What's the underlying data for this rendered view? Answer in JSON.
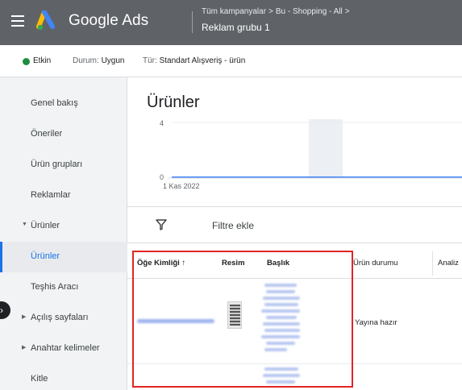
{
  "header": {
    "brand": "Google Ads",
    "breadcrumb": [
      "Tüm kampanyalar",
      "Bu - Shopping - All"
    ],
    "adgroup_title": "Reklam grubu 1"
  },
  "status": {
    "active": "Etkin",
    "state_label": "Durum:",
    "state_value": "Uygun",
    "type_label": "Tür:",
    "type_value": "Standart Alışveriş - ürün",
    "active_color": "#1e8e3e"
  },
  "sidebar": {
    "items": [
      {
        "label": "Genel bakış"
      },
      {
        "label": "Öneriler"
      },
      {
        "label": "Ürün grupları"
      },
      {
        "label": "Reklamlar"
      },
      {
        "label": "Ürünler",
        "expanded": true
      },
      {
        "label": "Ürünler",
        "active": true
      },
      {
        "label": "Teşhis Aracı"
      },
      {
        "label": "Açılış sayfaları"
      },
      {
        "label": "Anahtar kelimeler"
      },
      {
        "label": "Kitle"
      }
    ]
  },
  "main": {
    "title": "Ürünler",
    "chart": {
      "y_top": "4",
      "y_bottom": "0",
      "x_label": "1 Kas 2022"
    },
    "filter_label": "Filtre ekle",
    "table": {
      "columns": [
        "Öğe Kimliği",
        "Resim",
        "Başlık",
        "Ürün durumu",
        "Analiz"
      ],
      "rows": [
        {
          "id": "(blurred)",
          "image": "thumbnail",
          "title": "(blurred)",
          "status": "Yayına hazır"
        }
      ]
    }
  },
  "colors": {
    "topbar": "#5f6368",
    "accent": "#1a73e8",
    "highlight": "#e32424"
  }
}
